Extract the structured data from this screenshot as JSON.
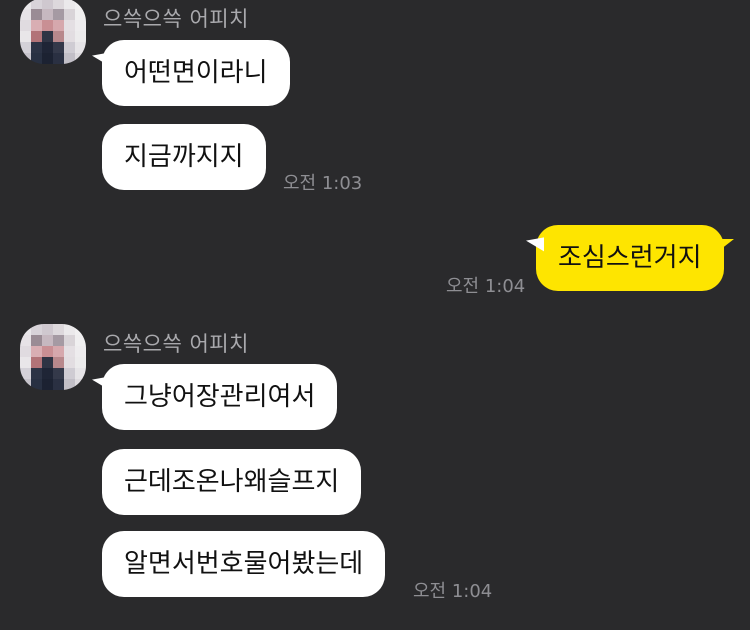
{
  "colors": {
    "background": "#2a2a2c",
    "incoming_bubble": "#ffffff",
    "outgoing_bubble": "#fee500",
    "meta_text": "#8e8e93"
  },
  "groups": [
    {
      "sender": "으쓱으쓱 어피치",
      "avatar": "pixelated-avatar",
      "messages": [
        "어떤면이라니",
        "지금까지지"
      ],
      "time": "오전 1:03"
    },
    {
      "mine": true,
      "messages": [
        "조심스런거지"
      ],
      "time": "오전 1:04"
    },
    {
      "sender": "으쓱으쓱 어피치",
      "avatar": "pixelated-avatar",
      "messages": [
        "그냥어장관리여서",
        "근데조온나왜슬프지",
        "알면서번호물어봤는데"
      ],
      "time": "오전 1:04"
    }
  ]
}
